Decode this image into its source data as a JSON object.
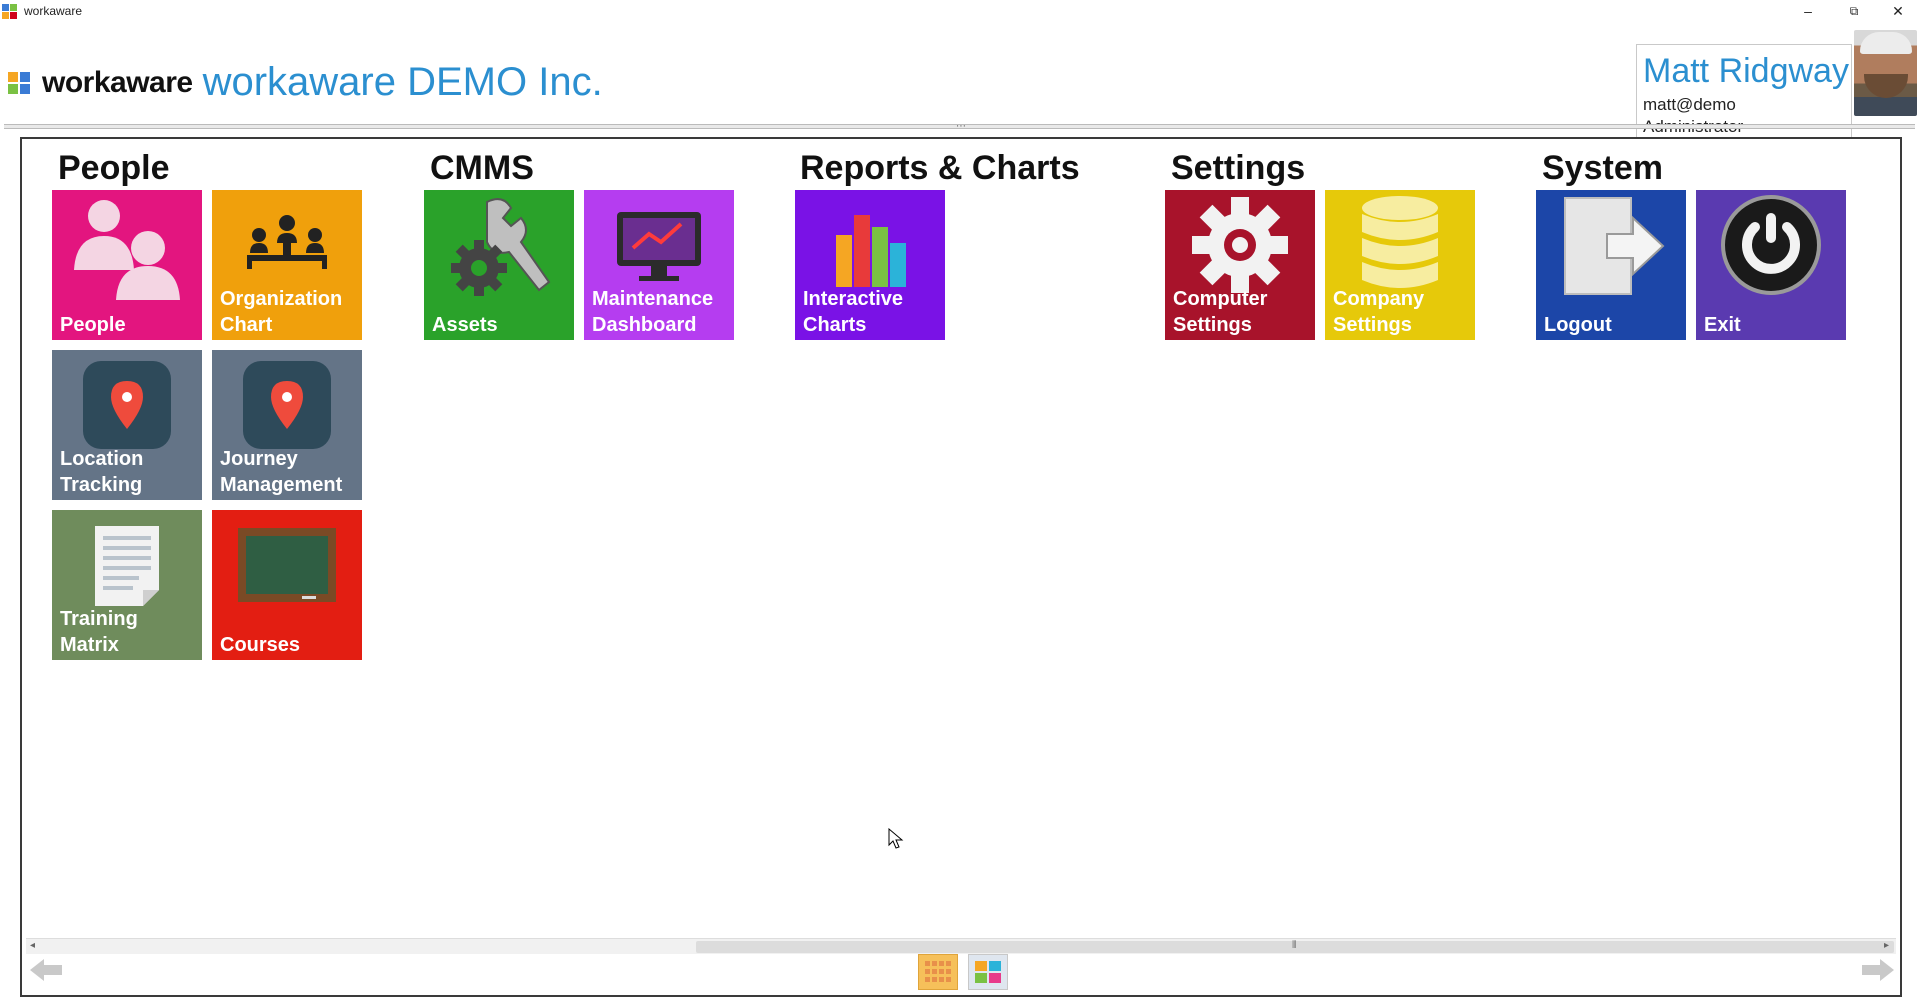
{
  "window": {
    "title": "workaware",
    "minimize_glyph": "–",
    "restore_glyph": "⧉",
    "close_glyph": "✕"
  },
  "header": {
    "brand": "workaware",
    "company": "workaware DEMO Inc."
  },
  "user": {
    "name": "Matt Ridgway",
    "email": "matt@demo",
    "role": "Administrator"
  },
  "groups": [
    {
      "title": "People",
      "tiles": [
        {
          "label": "People",
          "color": "#e3157f",
          "icon": "people-icon"
        },
        {
          "label": "Organization\nChart",
          "color": "#f0a00c",
          "icon": "org-chart-icon"
        },
        {
          "label": "Location\nTracking",
          "color": "#647487",
          "icon": "map-pin-icon"
        },
        {
          "label": "Journey\nManagement",
          "color": "#647487",
          "icon": "map-pin-icon"
        },
        {
          "label": "Training\nMatrix",
          "color": "#6f8c5c",
          "icon": "document-icon"
        },
        {
          "label": "Courses",
          "color": "#e31e12",
          "icon": "chalkboard-icon"
        }
      ]
    },
    {
      "title": "CMMS",
      "tiles": [
        {
          "label": "Assets",
          "color": "#2aa22a",
          "icon": "wrench-gear-icon"
        },
        {
          "label": "Maintenance\nDashboard",
          "color": "#b53df0",
          "icon": "monitor-chart-icon"
        }
      ]
    },
    {
      "title": "Reports & Charts",
      "tiles": [
        {
          "label": "Interactive\nCharts",
          "color": "#7a12e6",
          "icon": "bar-chart-icon"
        }
      ]
    },
    {
      "title": "Settings",
      "tiles": [
        {
          "label": "Computer\nSettings",
          "color": "#a8132b",
          "icon": "gear-icon"
        },
        {
          "label": "Company\nSettings",
          "color": "#e6c90a",
          "icon": "database-icon"
        }
      ]
    },
    {
      "title": "System",
      "tiles": [
        {
          "label": "Logout",
          "color": "#1c46a8",
          "icon": "logout-icon"
        },
        {
          "label": "Exit",
          "color": "#5a3ab0",
          "icon": "power-icon"
        }
      ]
    }
  ],
  "footer": {
    "scroll_left_glyph": "◂",
    "scroll_right_glyph": "▸",
    "thumb_grip_glyph": "⦀"
  }
}
